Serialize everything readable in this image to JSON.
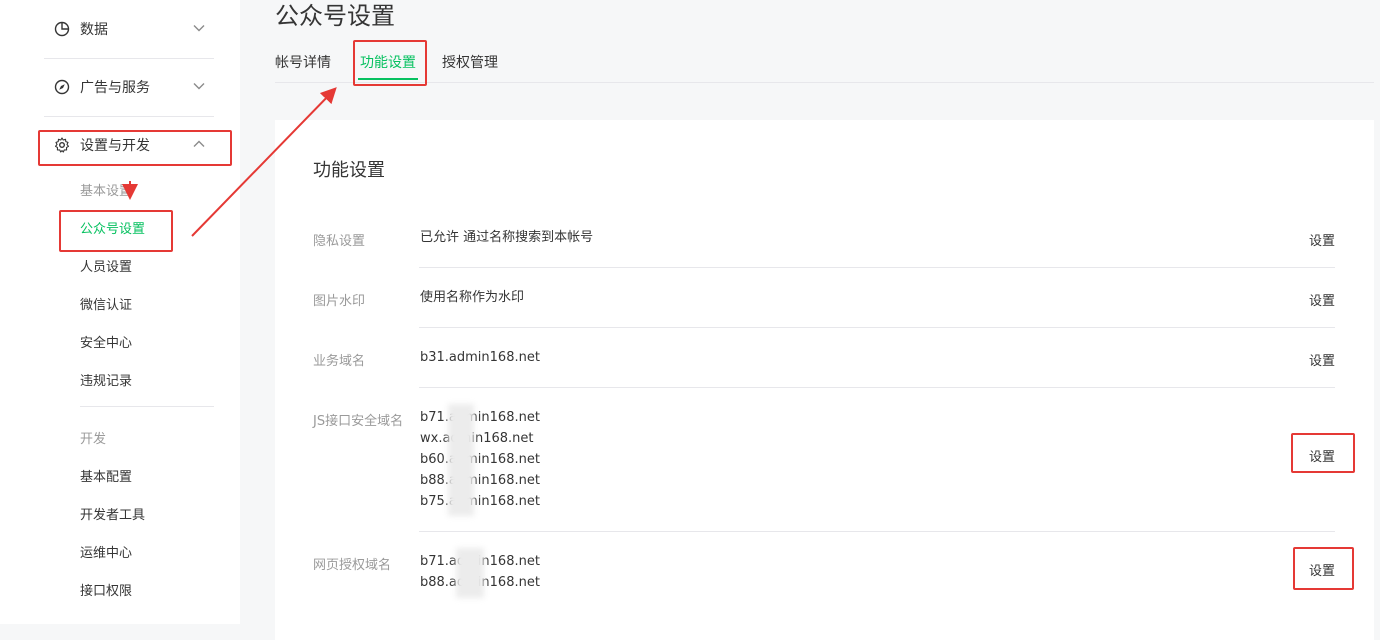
{
  "sidebar": {
    "groups": [
      {
        "label": "数据",
        "icon": "pie-chart-icon",
        "expanded": false
      },
      {
        "label": "广告与服务",
        "icon": "compass-icon",
        "expanded": false
      },
      {
        "label": "设置与开发",
        "icon": "gear-icon",
        "expanded": true
      }
    ],
    "settings_items": [
      "基本设置",
      "公众号设置",
      "人员设置",
      "微信认证",
      "安全中心",
      "违规记录"
    ],
    "dev_section": "开发",
    "dev_items": [
      "基本配置",
      "开发者工具",
      "运维中心",
      "接口权限"
    ]
  },
  "page": {
    "title": "公众号设置",
    "tabs": [
      "帐号详情",
      "功能设置",
      "授权管理"
    ],
    "active_tab": "功能设置"
  },
  "card": {
    "title": "功能设置",
    "rows": [
      {
        "label": "隐私设置",
        "value": "已允许 通过名称搜索到本帐号",
        "action": "设置"
      },
      {
        "label": "图片水印",
        "value": "使用名称作为水印",
        "action": "设置"
      },
      {
        "label": "业务域名",
        "value": "b31.admin168.net",
        "action": "设置"
      },
      {
        "label": "JS接口安全域名",
        "values": [
          "b71.admin168.net",
          "wx.admin168.net",
          "b60.admin168.net",
          "b88.admin168.net",
          "b75.admin168.net"
        ],
        "action": "设置"
      },
      {
        "label": "网页授权域名",
        "values": [
          "b71.admin168.net",
          "b88.admin168.net"
        ],
        "action": "设置"
      }
    ]
  },
  "colors": {
    "accent": "#07c160",
    "annotation": "#e53935",
    "link": "#576b95"
  }
}
